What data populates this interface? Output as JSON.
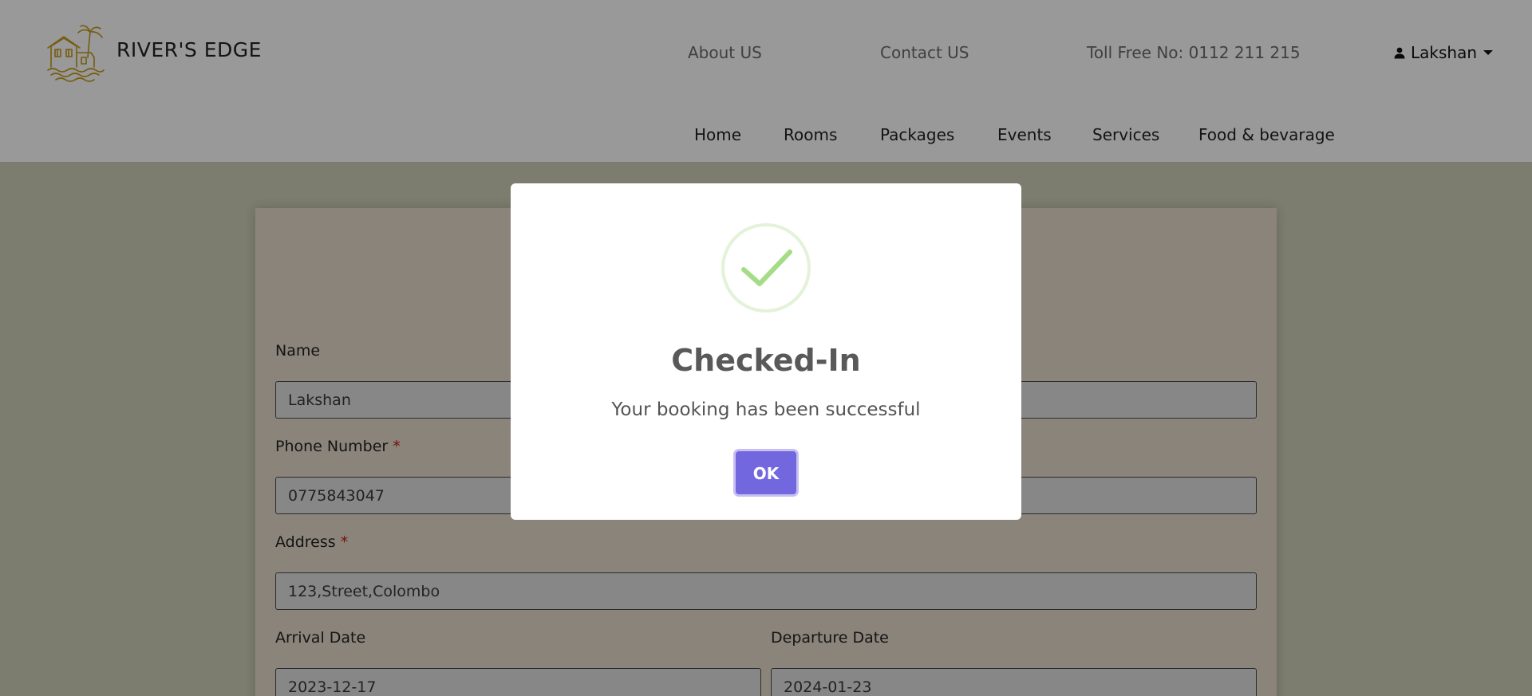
{
  "brand": {
    "name": "RIVER'S EDGE",
    "logo_icon": "house-palm-logo-icon",
    "logo_color": "#c49a1a"
  },
  "top_links": {
    "about": "About US",
    "contact": "Contact US",
    "toll_free": "Toll Free No: 0112 211 215"
  },
  "user": {
    "name": "Lakshan",
    "icon": "user-icon"
  },
  "nav": {
    "home": "Home",
    "rooms": "Rooms",
    "packages": "Packages",
    "events": "Events",
    "services": "Services",
    "food": "Food & bevarage"
  },
  "form": {
    "name_label": "Name",
    "name_value": "Lakshan",
    "phone_label": "Phone Number",
    "phone_value": "0775843047",
    "address_label": "Address",
    "address_value": "123,Street,Colombo",
    "arrival_label": "Arrival Date",
    "arrival_value": "2023-12-17",
    "departure_label": "Departure Date",
    "departure_value": "2024-01-23",
    "required_mark": "*"
  },
  "modal": {
    "icon": "success-check-icon",
    "title": "Checked-In",
    "text": "Your booking has been successful",
    "ok_label": "OK",
    "accent": "#7367e0",
    "check_color": "#a5dc86"
  }
}
